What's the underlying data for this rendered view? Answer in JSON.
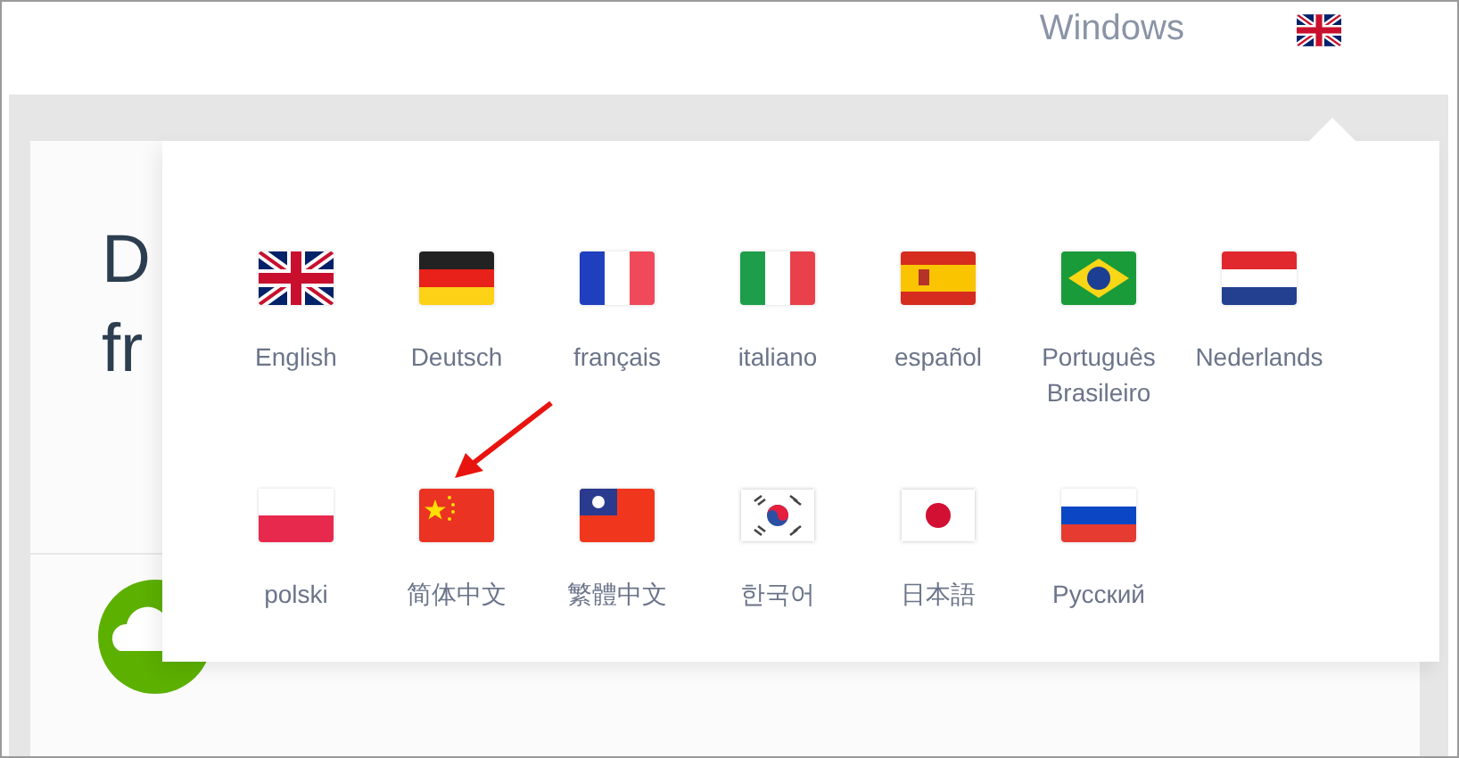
{
  "top_bar": {
    "platform_link": "Windows",
    "language_button": {
      "kind": "gb"
    }
  },
  "background_card": {
    "heading_lines": [
      "D",
      "fr"
    ]
  },
  "language_menu": {
    "languages": [
      {
        "label": "English",
        "kind": "gb"
      },
      {
        "label": "Deutsch",
        "kind": "de"
      },
      {
        "label": "français",
        "kind": "fr"
      },
      {
        "label": "italiano",
        "kind": "it"
      },
      {
        "label": "español",
        "kind": "es"
      },
      {
        "label": "Português Brasileiro",
        "kind": "br"
      },
      {
        "label": "Nederlands",
        "kind": "nl"
      },
      {
        "label": "polski",
        "kind": "pl"
      },
      {
        "label": "简体中文",
        "kind": "cn"
      },
      {
        "label": "繁體中文",
        "kind": "tw"
      },
      {
        "label": "한국어",
        "kind": "kr"
      },
      {
        "label": "日本語",
        "kind": "jp"
      },
      {
        "label": "Русский",
        "kind": "ru"
      }
    ]
  }
}
